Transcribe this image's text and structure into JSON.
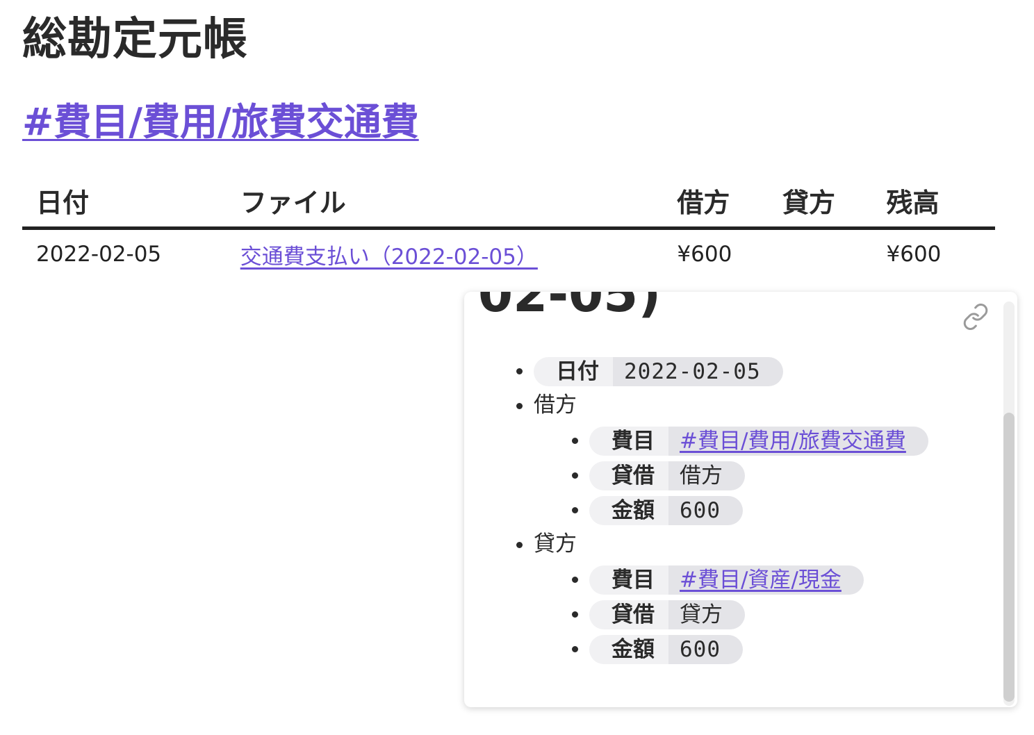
{
  "page": {
    "title": "総勘定元帳",
    "account_link": "#費目/費用/旅費交通費"
  },
  "table": {
    "headers": {
      "date": "日付",
      "file": "ファイル",
      "debit": "借方",
      "credit": "貸方",
      "balance": "残高"
    },
    "rows": [
      {
        "date": "2022-02-05",
        "file": "交通費支払い（2022-02-05）",
        "debit": "¥600",
        "credit": "",
        "balance": "¥600"
      }
    ]
  },
  "popover": {
    "title_fragment": "02-05)",
    "link_icon": "link-icon",
    "date_key": "日付",
    "date_value": "2022-02-05",
    "debit": {
      "label": "借方",
      "account_key": "費目",
      "account_value": "#費目/費用/旅費交通費",
      "side_key": "貸借",
      "side_value": "借方",
      "amount_key": "金額",
      "amount_value": "600"
    },
    "credit": {
      "label": "貸方",
      "account_key": "費目",
      "account_value": "#費目/資産/現金",
      "side_key": "貸借",
      "side_value": "貸方",
      "amount_key": "金額",
      "amount_value": "600"
    }
  },
  "colors": {
    "link": "#6b4fd6",
    "text": "#2a2a2a",
    "pill_key_bg": "#f1f1f3",
    "pill_value_bg": "#e4e4e8"
  }
}
